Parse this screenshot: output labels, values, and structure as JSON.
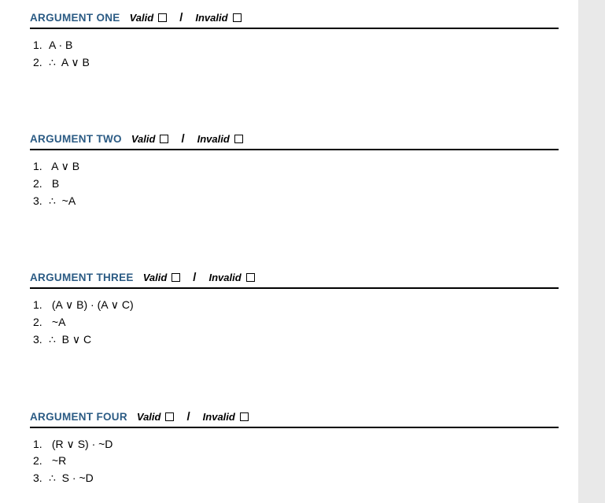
{
  "validLabel": "Valid",
  "invalidLabel": "Invalid",
  "separator": "/",
  "arguments": [
    {
      "title": "ARGUMENT ONE",
      "lines": [
        {
          "num": "1.",
          "text": "A · B"
        },
        {
          "num": "2.",
          "text": "∴  A ∨ B"
        }
      ]
    },
    {
      "title": "ARGUMENT TWO",
      "lines": [
        {
          "num": "1.",
          "text": " A ∨ B"
        },
        {
          "num": "2.",
          "text": " B"
        },
        {
          "num": "3.",
          "text": "∴  ~A"
        }
      ]
    },
    {
      "title": "ARGUMENT THREE",
      "lines": [
        {
          "num": "1.",
          "text": " (A ∨ B) · (A ∨ C)"
        },
        {
          "num": "2.",
          "text": " ~A"
        },
        {
          "num": "3.",
          "text": "∴  B ∨ C"
        }
      ]
    },
    {
      "title": "ARGUMENT FOUR",
      "lines": [
        {
          "num": "1.",
          "text": " (R ∨ S) · ~D"
        },
        {
          "num": "2.",
          "text": " ~R"
        },
        {
          "num": "3.",
          "text": "∴  S · ~D"
        }
      ]
    }
  ]
}
